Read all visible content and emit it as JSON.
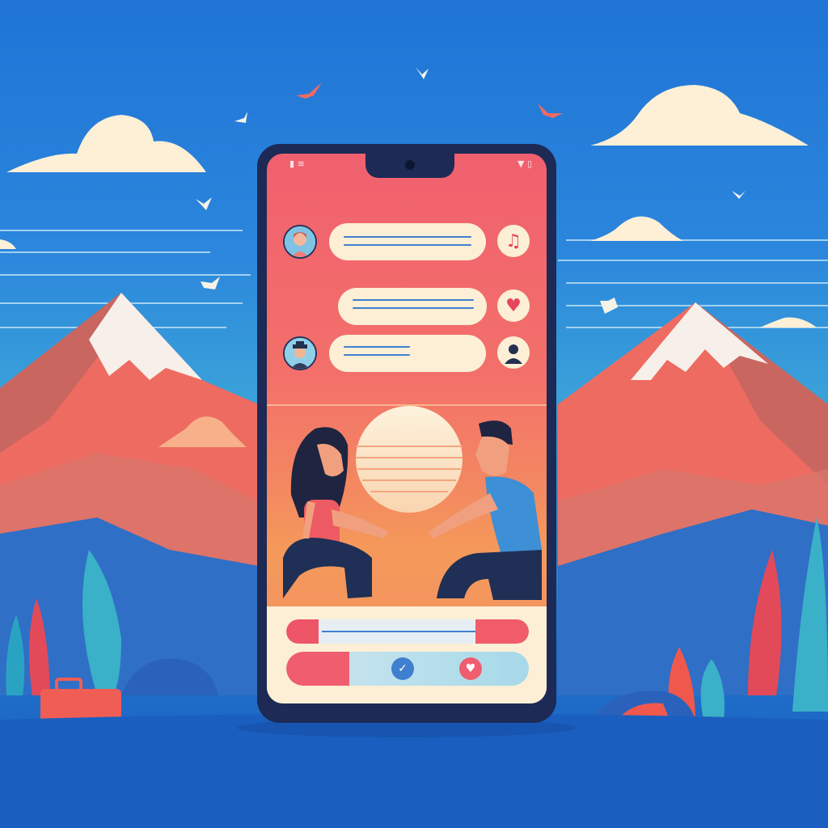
{
  "status_bar": {
    "left": "",
    "right": "▼ ▯"
  },
  "chat": {
    "messages": [
      {
        "action_icon": "music-note-icon",
        "action_glyph": "♫"
      },
      {
        "action_icon": "heart-icon",
        "action_glyph": "♥"
      },
      {
        "action_icon": "person-icon",
        "action_glyph": ""
      }
    ]
  },
  "player": {
    "time": "",
    "controls": [
      "",
      "",
      ""
    ]
  },
  "colors": {
    "sky": "#2b86dc",
    "screen_top": "#f0606e",
    "screen_bottom": "#f5995a",
    "bubble": "#fcefd6",
    "phone_frame": "#1c2a55",
    "accent_red": "#f05d6e",
    "line_blue": "#3f7fcf"
  }
}
